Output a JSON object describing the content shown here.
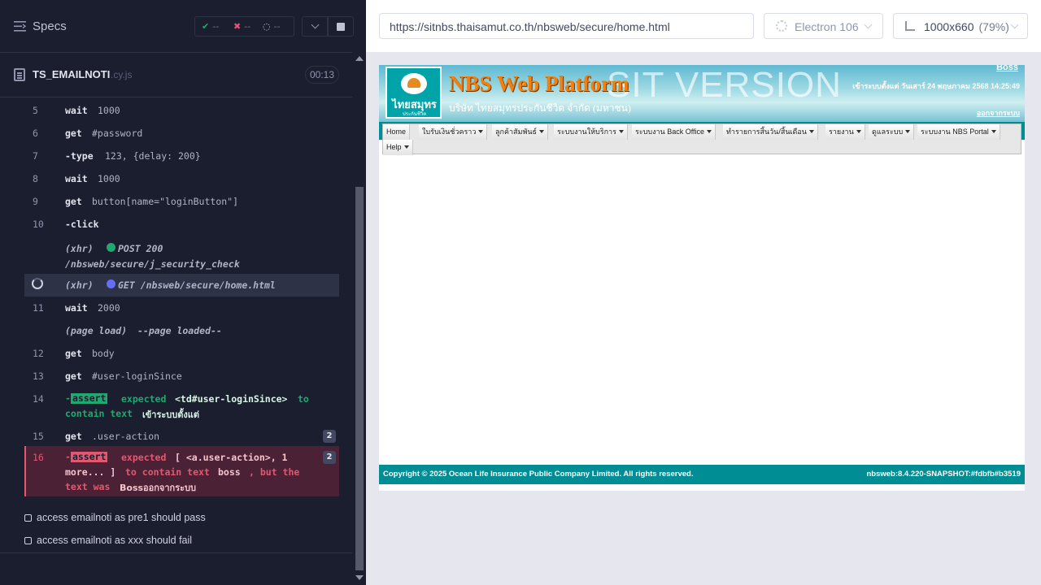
{
  "reporter": {
    "header": {
      "title": "Specs",
      "pass_count": "--",
      "fail_count": "--",
      "pending_count": "--"
    },
    "file": {
      "name": "TS_EMAILNOTI",
      "ext": ".cy.js",
      "duration": "00:13"
    },
    "commands": [
      {
        "num": "5",
        "name": "wait",
        "msg": "1000"
      },
      {
        "num": "6",
        "name": "get",
        "msg": "#password"
      },
      {
        "num": "7",
        "name": "-type",
        "msg": "123, {delay: 200}"
      },
      {
        "num": "8",
        "name": "wait",
        "msg": "1000"
      },
      {
        "num": "9",
        "name": "get",
        "msg": "button[name=\"loginButton\"]"
      },
      {
        "num": "10",
        "name": "-click",
        "msg": ""
      },
      {
        "num": "",
        "name": "(xhr)",
        "method": "POST 200",
        "url": "/nbsweb/secure/j_security_check"
      },
      {
        "num": "",
        "name": "(xhr)",
        "method": "GET /nbsweb/secure/home.html"
      },
      {
        "num": "11",
        "name": "wait",
        "msg": "2000"
      },
      {
        "num": "",
        "name": "(page load)",
        "msg": "--page loaded--"
      },
      {
        "num": "12",
        "name": "get",
        "msg": "body"
      },
      {
        "num": "13",
        "name": "get",
        "msg": "#user-loginSince"
      },
      {
        "num": "14",
        "name": "-assert",
        "msg_pre": "expected",
        "subject": "<td#user-loginSince>",
        "msg_mid": "to",
        "msg_line2": "contain text",
        "value": "เข้าระบบตั้งแต่"
      },
      {
        "num": "15",
        "name": "get",
        "msg": ".user-action",
        "count": "2"
      },
      {
        "num": "16",
        "name": "-assert",
        "msg_pre": "expected",
        "subject": "[ <a.user-action>, 1",
        "line2_a": "more... ]",
        "line2_b": "to contain text",
        "line2_c": "boss",
        "line2_d": ", but the",
        "line3_a": "text was",
        "line3_b": "Bossออกจากระบบ",
        "count": "2"
      }
    ],
    "tests": [
      {
        "title": "access emailnoti as pre1 should pass"
      },
      {
        "title": "access emailnoti as xxx should fail"
      }
    ]
  },
  "aut": {
    "url": "https://sitnbs.thaisamut.co.th/nbsweb/secure/home.html",
    "browser": "Electron 106",
    "viewport": "1000x660",
    "zoom": "(79%)",
    "app": {
      "logo_text": "ไทยสมุทร",
      "logo_sub": "ประกันชีวิต",
      "title": "NBS Web Platform",
      "watermark": "SIT VERSION",
      "company": "บริษัท ไทยสมุทรประกันชีวิต จำกัด (มหาชน)",
      "user": "Boss",
      "login_since": "เข้าระบบตั้งแต่ วันเสาร์ 24 พฤษภาคม 2568 14:25:49",
      "logout": "ออกจากระบบ",
      "menu": [
        "Home",
        "ใบรับเงินชั่วคราว",
        "ลูกค้าสัมพันธ์",
        "ระบบงานให้บริการ",
        "ระบบงาน Back Office",
        "ทำรายการสิ้นวัน/สิ้นเดือน",
        "รายงาน",
        "ดูแลระบบ",
        "ระบบงาน NBS Portal",
        "Help"
      ],
      "footer_copy": "Copyright © 2025 Ocean Life Insurance Public Company Limited.  All rights reserved.",
      "footer_version": "nbsweb:8.4.220-SNAPSHOT:#fdbfb#b3519"
    }
  },
  "colors": {
    "pass": "#1fa971",
    "fail": "#e45770",
    "xhr_green": "#1fa971",
    "xhr_blue": "#6470f3",
    "teal": "#008d93"
  }
}
